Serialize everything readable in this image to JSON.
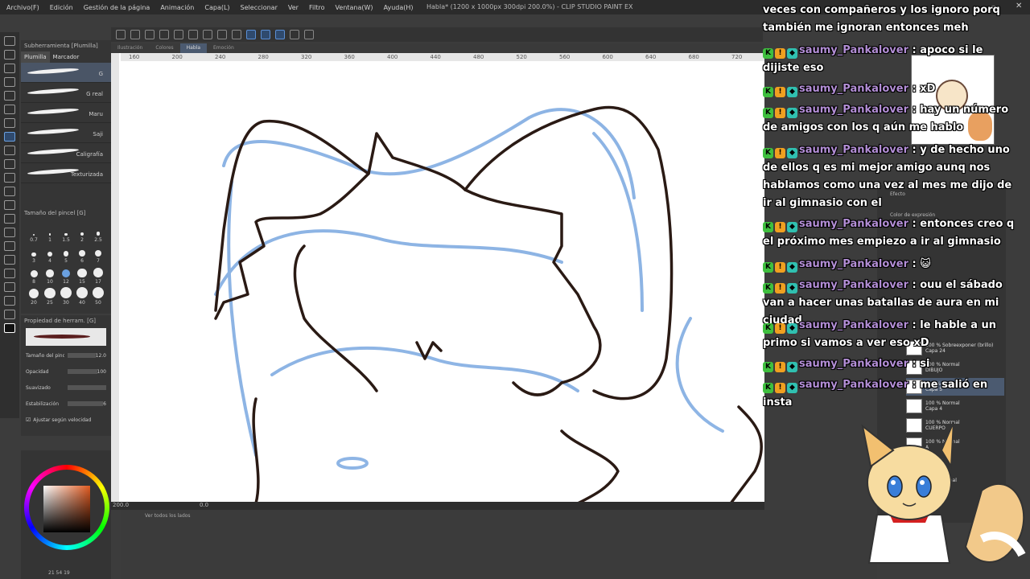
{
  "menu": [
    "Archivo(F)",
    "Edición",
    "Gestión de la página",
    "Animación",
    "Capa(L)",
    "Seleccionar",
    "Ver",
    "Filtro",
    "Ventana(W)",
    "Ayuda(H)"
  ],
  "window_title": "Habla* (1200 x 1000px 300dpi 200.0%) - CLIP STUDIO PAINT EX",
  "document_tabs": [
    "Ilustración",
    "Colores",
    "Habla",
    "Emoción"
  ],
  "active_document_tab": "Habla",
  "subtool_panel": {
    "title": "Subherramienta [Plumilla]",
    "tabs": [
      "Plumilla",
      "Marcador"
    ],
    "brushes": [
      "G",
      "G real",
      "Maru",
      "Saji",
      "Caligrafía",
      "Texturizada"
    ]
  },
  "brush_size": {
    "title": "Tamaño del pincel [G]",
    "sizes": [
      "0.7",
      "1",
      "1.5",
      "2",
      "2.5",
      "3",
      "4",
      "5",
      "6",
      "7",
      "8",
      "10",
      "12",
      "15",
      "17",
      "20",
      "25",
      "30",
      "40",
      "50"
    ],
    "selected": "12"
  },
  "tool_property": {
    "title": "Propiedad de herram. [G]",
    "rows": [
      {
        "label": "Tamaño del pincel",
        "value": "12.0"
      },
      {
        "label": "Opacidad",
        "value": "100"
      },
      {
        "label": "Suavizado",
        "value": ""
      },
      {
        "label": "Estabilización",
        "value": "6"
      }
    ],
    "checkbox": "Ajustar según velocidad"
  },
  "ruler": [
    "160",
    "200",
    "240",
    "280",
    "320",
    "360",
    "400",
    "440",
    "480",
    "520",
    "560",
    "600",
    "640",
    "680",
    "720"
  ],
  "status": {
    "zoom": "200.0",
    "rotation": "0.0"
  },
  "timeline": {
    "label": "Ver todos los lados"
  },
  "color_panel": {
    "values": "21 54 19"
  },
  "layer_panel": {
    "effect_label": "Efecto",
    "expression_label": "Color de expresión",
    "layers": [
      {
        "line1": "100 % Sobreexponer (brillo)",
        "line2": "Capa 24",
        "selected": false
      },
      {
        "line1": "100 % Normal",
        "line2": "DIBUJO",
        "selected": false
      },
      {
        "line1": "100 % Normal",
        "line2": "Capa 5",
        "selected": true
      },
      {
        "line1": "100 % Normal",
        "line2": "Capa 4",
        "selected": false
      },
      {
        "line1": "100 % Normal",
        "line2": "CUERPO",
        "selected": false
      },
      {
        "line1": "100 % Normal",
        "line2": "A",
        "selected": false
      },
      {
        "line1": "Normal",
        "line2": "A - copia",
        "selected": false
      },
      {
        "line1": "38 % Normal",
        "line2": "Capa 1",
        "selected": false
      },
      {
        "line1": "Papel",
        "line2": "",
        "selected": false
      }
    ]
  },
  "chat": {
    "lines": [
      {
        "user": "",
        "text": "veces con compañeros y los ignoro porq también me ignoran entonces meh"
      },
      {
        "user": "saumy_Pankalover",
        "text": ": apoco si le dijiste eso"
      },
      {
        "user": "saumy_Pankalover",
        "text": ": xD"
      },
      {
        "user": "saumy_Pankalover",
        "text": ": hay un número de amigos con los q aún me hablo"
      },
      {
        "user": "saumy_Pankalover",
        "text": ": y de hecho uno de ellos q es mi mejor amigo aunq nos hablamos como una vez al mes me dijo de ir al gimnasio con el"
      },
      {
        "user": "saumy_Pankalover",
        "text": ": entonces creo q el próximo mes empiezo a ir al gimnasio"
      },
      {
        "user": "saumy_Pankalover",
        "text": ": 😺"
      },
      {
        "user": "saumy_Pankalover",
        "text": ": ouu el sábado van a hacer unas batallas de aura en mi ciudad"
      },
      {
        "user": "saumy_Pankalover",
        "text": ": le hable a un primo si vamos a ver eso xD"
      },
      {
        "user": "saumy_Pankalover",
        "text": ": si"
      },
      {
        "user": "saumy_Pankalover",
        "text": ": me salió en insta"
      }
    ],
    "badge_colors": [
      "#3fbf3f",
      "#f0a020",
      "#30c0b0"
    ]
  }
}
